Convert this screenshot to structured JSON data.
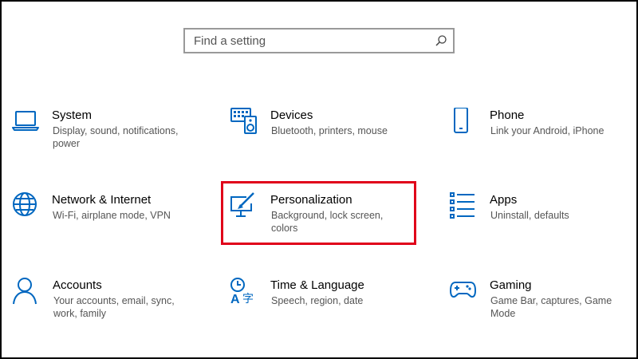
{
  "search": {
    "placeholder": "Find a setting",
    "icon": "search-icon"
  },
  "accent_color": "#0067c0",
  "highlight_color": "#e0001a",
  "tiles": [
    {
      "id": "system",
      "title": "System",
      "desc": "Display, sound, notifications, power",
      "icon": "laptop-icon"
    },
    {
      "id": "devices",
      "title": "Devices",
      "desc": "Bluetooth, printers, mouse",
      "icon": "keyboard-speaker-icon"
    },
    {
      "id": "phone",
      "title": "Phone",
      "desc": "Link your Android, iPhone",
      "icon": "phone-icon"
    },
    {
      "id": "network",
      "title": "Network & Internet",
      "desc": "Wi-Fi, airplane mode, VPN",
      "icon": "globe-icon"
    },
    {
      "id": "personalization",
      "title": "Personalization",
      "desc": "Background, lock screen, colors",
      "icon": "paint-monitor-icon",
      "highlighted": true
    },
    {
      "id": "apps",
      "title": "Apps",
      "desc": "Uninstall, defaults",
      "icon": "apps-list-icon"
    },
    {
      "id": "accounts",
      "title": "Accounts",
      "desc": "Your accounts, email, sync, work, family",
      "icon": "person-icon"
    },
    {
      "id": "time-language",
      "title": "Time & Language",
      "desc": "Speech, region, date",
      "icon": "time-language-icon"
    },
    {
      "id": "gaming",
      "title": "Gaming",
      "desc": "Game Bar, captures, Game Mode",
      "icon": "gamepad-icon"
    }
  ]
}
